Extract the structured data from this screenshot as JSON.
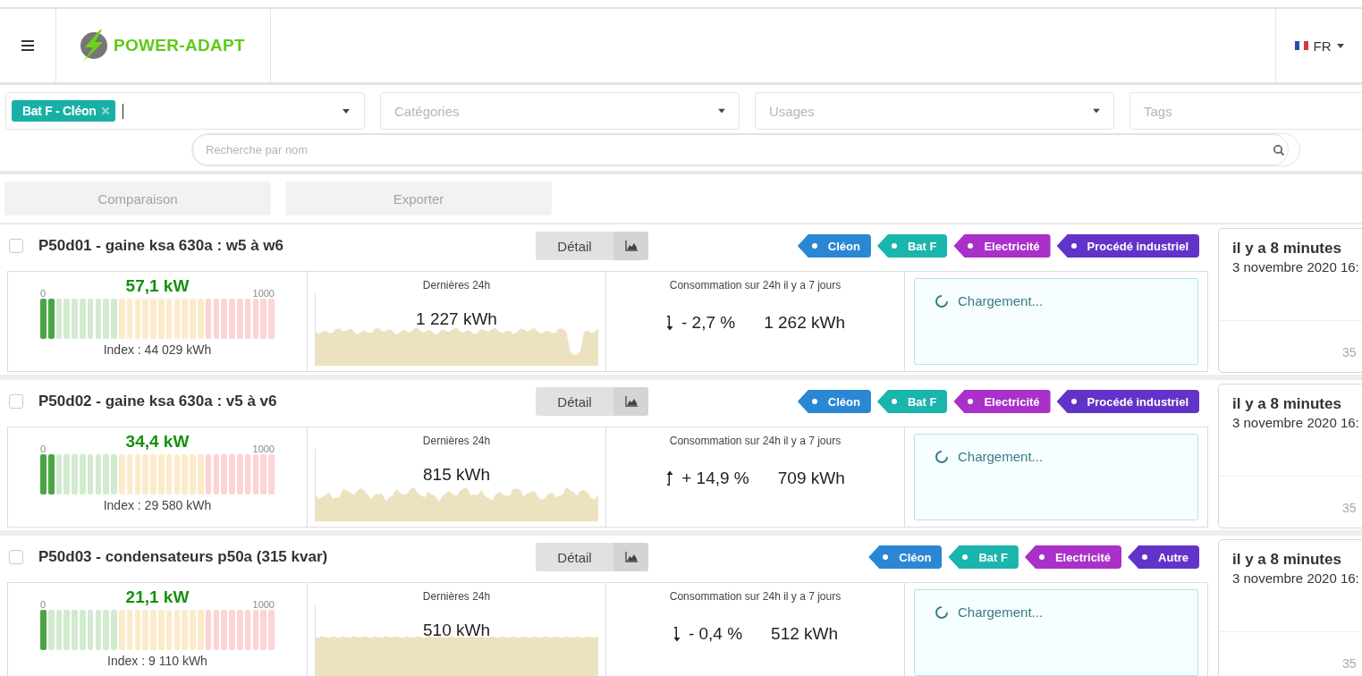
{
  "header": {
    "logo_text": "POWER-ADAPT",
    "language": "FR"
  },
  "filters": {
    "site_tag": "Bat F - Cléon",
    "categories_placeholder": "Catégories",
    "usages_placeholder": "Usages",
    "tags_placeholder": "Tags",
    "search_placeholder": "Recherche par nom"
  },
  "actions": [
    {
      "label": "Comparaison",
      "disabled": true
    },
    {
      "label": "Exporter",
      "disabled": true
    }
  ],
  "meters": [
    {
      "checked": false,
      "name": "P50d01 - gaine ksa 630a : w5 à w6",
      "detail_label": "Détail",
      "tags": [
        {
          "label": "Cléon",
          "color": "#2b87d3"
        },
        {
          "label": "Bat F",
          "color": "#1ab5ac"
        },
        {
          "label": "Electricité",
          "color": "#a930c9"
        },
        {
          "label": "Procédé industriel",
          "color": "#6233c9"
        }
      ],
      "power": "57,1 kW",
      "level": 0.0571,
      "scale_min": "0",
      "scale_max": "1000",
      "index": "Index : 44 029 kWh",
      "chart_title": "Dernières 24h",
      "total": "1 227 kWh",
      "compare_title": "Consommation sur 24h il y a 7 jours",
      "kind": "down",
      "change": "- 2,7 %",
      "previous": "1 262 kWh",
      "status": "Chargement...",
      "updated_relative": "il y a 8 minutes",
      "updated_date": "3 novembre 2020 16:",
      "footer_value": "35"
    },
    {
      "checked": false,
      "name": "P50d02 - gaine ksa 630a : v5 à v6",
      "detail_label": "Détail",
      "tags": [
        {
          "label": "Cléon",
          "color": "#2b87d3"
        },
        {
          "label": "Bat F",
          "color": "#1ab5ac"
        },
        {
          "label": "Electricité",
          "color": "#a930c9"
        },
        {
          "label": "Procédé industriel",
          "color": "#6233c9"
        }
      ],
      "power": "34,4 kW",
      "level": 0.0344,
      "scale_min": "0",
      "scale_max": "1000",
      "index": "Index : 29 580 kWh",
      "chart_title": "Dernières 24h",
      "total": "815 kWh",
      "compare_title": "Consommation sur 24h il y a 7 jours",
      "kind": "up",
      "change": "+ 14,9 %",
      "previous": "709 kWh",
      "status": "Chargement...",
      "updated_relative": "il y a 8 minutes",
      "updated_date": "3 novembre 2020 16:",
      "footer_value": "35"
    },
    {
      "checked": false,
      "name": "P50d03 - condensateurs p50a (315 kvar)",
      "detail_label": "Détail",
      "tags": [
        {
          "label": "Cléon",
          "color": "#2b87d3"
        },
        {
          "label": "Bat F",
          "color": "#1ab5ac"
        },
        {
          "label": "Electricité",
          "color": "#a930c9"
        },
        {
          "label": "Autre",
          "color": "#6233c9"
        }
      ],
      "power": "21,1 kW",
      "level": 0.0211,
      "scale_min": "0",
      "scale_max": "1000",
      "index": "Index : 9 110 kWh",
      "chart_title": "Dernières 24h",
      "total": "510 kWh",
      "compare_title": "Consommation sur 24h il y a 7 jours",
      "kind": "down",
      "change": "- 0,4 %",
      "previous": "512 kWh",
      "status": "Chargement...",
      "updated_relative": "il y a 8 minutes",
      "updated_date": "3 novembre 2020 16:",
      "footer_value": "35"
    }
  ]
}
